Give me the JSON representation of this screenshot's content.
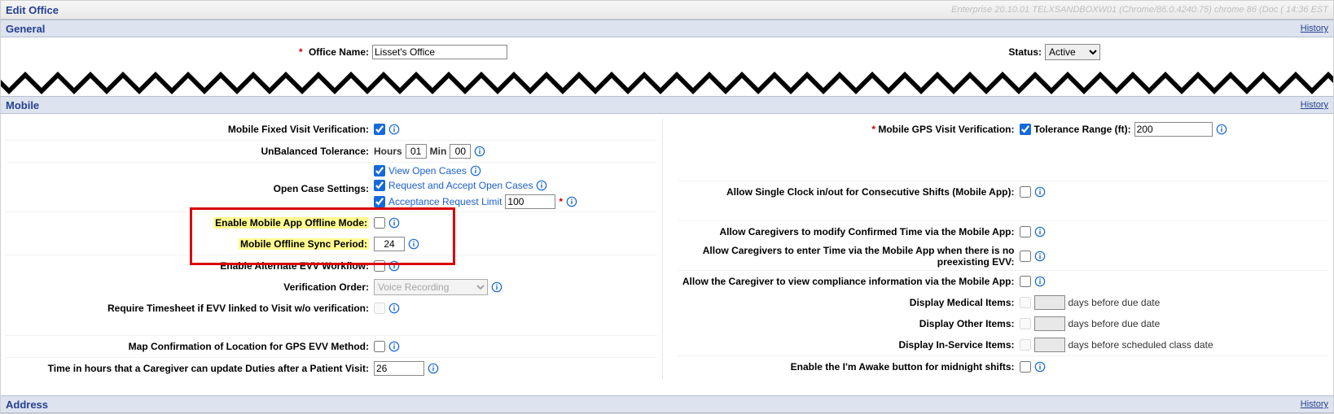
{
  "title": "Edit Office",
  "system_line": "Enterprise 20.10.01 TELXSANDBOXW01 (Chrome/86.0.4240.75) chrome 86 (Doc ( 14:36 EST",
  "history_link": "History",
  "general": {
    "heading": "General",
    "office_name_label": "Office Name:",
    "office_name_value": "Lisset's Office",
    "status_label": "Status:",
    "status_value": "Active"
  },
  "mobile": {
    "heading": "Mobile",
    "fixed_visit_label": "Mobile Fixed Visit Verification:",
    "gps_label": "Mobile GPS Visit Verification:",
    "tolerance_range_label": "Tolerance Range (ft):",
    "tolerance_range_value": "200",
    "unbalanced_label": "UnBalanced Tolerance:",
    "hours_word": "Hours",
    "hours_value": "01",
    "min_word": "Min",
    "min_value": "00",
    "open_case_settings_label": "Open Case Settings:",
    "view_open_cases": "View Open Cases",
    "request_accept_open_cases": "Request and Accept Open Cases",
    "acceptance_limit_label": "Acceptance Request Limit",
    "acceptance_limit_value": "100",
    "enable_offline_label": "Enable Mobile App Offline Mode:",
    "offline_sync_label": "Mobile Offline Sync Period:",
    "offline_sync_value": "24",
    "enable_alt_evv_label": "Enable Alternate EVV Workflow:",
    "verification_order_label": "Verification Order:",
    "verification_order_value": "Voice Recording",
    "require_timesheet_label": "Require Timesheet if EVV linked to Visit w/o verification:",
    "map_confirm_label": "Map Confirmation of Location for GPS EVV Method:",
    "duties_hours_label": "Time in hours that a Caregiver can update Duties after a Patient Visit:",
    "duties_hours_value": "26",
    "allow_single_clock_label": "Allow Single Clock in/out for Consecutive Shifts (Mobile App):",
    "allow_modify_confirmed_label": "Allow Caregivers to modify Confirmed Time via the Mobile App:",
    "allow_enter_no_evv_label": "Allow Caregivers to enter Time via the Mobile App when there is no preexisting EVV:",
    "allow_view_compliance_label": "Allow the Caregiver to view compliance information via the Mobile App:",
    "display_medical_label": "Display Medical Items:",
    "display_other_label": "Display Other Items:",
    "display_inservice_label": "Display In-Service Items:",
    "days_before_due": "days before due date",
    "days_before_class": "days before scheduled class date",
    "im_awake_label": "Enable the I'm Awake button for midnight shifts:"
  },
  "address_heading": "Address"
}
